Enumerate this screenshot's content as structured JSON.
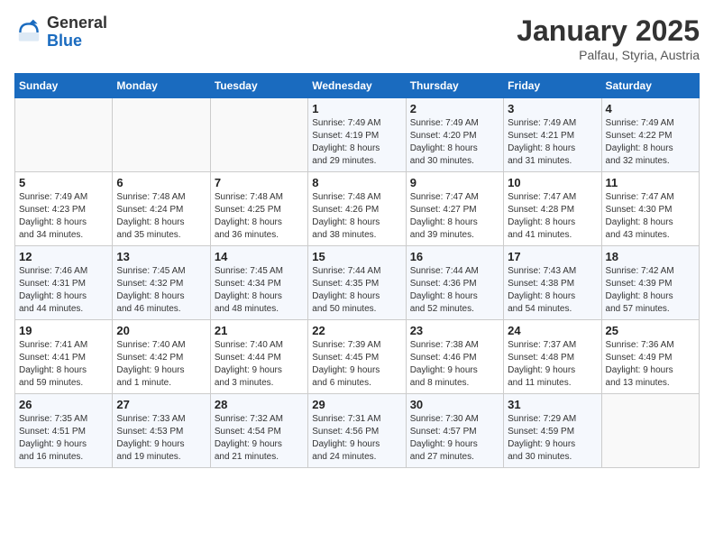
{
  "logo": {
    "general": "General",
    "blue": "Blue"
  },
  "header": {
    "month": "January 2025",
    "location": "Palfau, Styria, Austria"
  },
  "weekdays": [
    "Sunday",
    "Monday",
    "Tuesday",
    "Wednesday",
    "Thursday",
    "Friday",
    "Saturday"
  ],
  "weeks": [
    [
      {
        "day": "",
        "content": ""
      },
      {
        "day": "",
        "content": ""
      },
      {
        "day": "",
        "content": ""
      },
      {
        "day": "1",
        "content": "Sunrise: 7:49 AM\nSunset: 4:19 PM\nDaylight: 8 hours\nand 29 minutes."
      },
      {
        "day": "2",
        "content": "Sunrise: 7:49 AM\nSunset: 4:20 PM\nDaylight: 8 hours\nand 30 minutes."
      },
      {
        "day": "3",
        "content": "Sunrise: 7:49 AM\nSunset: 4:21 PM\nDaylight: 8 hours\nand 31 minutes."
      },
      {
        "day": "4",
        "content": "Sunrise: 7:49 AM\nSunset: 4:22 PM\nDaylight: 8 hours\nand 32 minutes."
      }
    ],
    [
      {
        "day": "5",
        "content": "Sunrise: 7:49 AM\nSunset: 4:23 PM\nDaylight: 8 hours\nand 34 minutes."
      },
      {
        "day": "6",
        "content": "Sunrise: 7:48 AM\nSunset: 4:24 PM\nDaylight: 8 hours\nand 35 minutes."
      },
      {
        "day": "7",
        "content": "Sunrise: 7:48 AM\nSunset: 4:25 PM\nDaylight: 8 hours\nand 36 minutes."
      },
      {
        "day": "8",
        "content": "Sunrise: 7:48 AM\nSunset: 4:26 PM\nDaylight: 8 hours\nand 38 minutes."
      },
      {
        "day": "9",
        "content": "Sunrise: 7:47 AM\nSunset: 4:27 PM\nDaylight: 8 hours\nand 39 minutes."
      },
      {
        "day": "10",
        "content": "Sunrise: 7:47 AM\nSunset: 4:28 PM\nDaylight: 8 hours\nand 41 minutes."
      },
      {
        "day": "11",
        "content": "Sunrise: 7:47 AM\nSunset: 4:30 PM\nDaylight: 8 hours\nand 43 minutes."
      }
    ],
    [
      {
        "day": "12",
        "content": "Sunrise: 7:46 AM\nSunset: 4:31 PM\nDaylight: 8 hours\nand 44 minutes."
      },
      {
        "day": "13",
        "content": "Sunrise: 7:45 AM\nSunset: 4:32 PM\nDaylight: 8 hours\nand 46 minutes."
      },
      {
        "day": "14",
        "content": "Sunrise: 7:45 AM\nSunset: 4:34 PM\nDaylight: 8 hours\nand 48 minutes."
      },
      {
        "day": "15",
        "content": "Sunrise: 7:44 AM\nSunset: 4:35 PM\nDaylight: 8 hours\nand 50 minutes."
      },
      {
        "day": "16",
        "content": "Sunrise: 7:44 AM\nSunset: 4:36 PM\nDaylight: 8 hours\nand 52 minutes."
      },
      {
        "day": "17",
        "content": "Sunrise: 7:43 AM\nSunset: 4:38 PM\nDaylight: 8 hours\nand 54 minutes."
      },
      {
        "day": "18",
        "content": "Sunrise: 7:42 AM\nSunset: 4:39 PM\nDaylight: 8 hours\nand 57 minutes."
      }
    ],
    [
      {
        "day": "19",
        "content": "Sunrise: 7:41 AM\nSunset: 4:41 PM\nDaylight: 8 hours\nand 59 minutes."
      },
      {
        "day": "20",
        "content": "Sunrise: 7:40 AM\nSunset: 4:42 PM\nDaylight: 9 hours\nand 1 minute."
      },
      {
        "day": "21",
        "content": "Sunrise: 7:40 AM\nSunset: 4:44 PM\nDaylight: 9 hours\nand 3 minutes."
      },
      {
        "day": "22",
        "content": "Sunrise: 7:39 AM\nSunset: 4:45 PM\nDaylight: 9 hours\nand 6 minutes."
      },
      {
        "day": "23",
        "content": "Sunrise: 7:38 AM\nSunset: 4:46 PM\nDaylight: 9 hours\nand 8 minutes."
      },
      {
        "day": "24",
        "content": "Sunrise: 7:37 AM\nSunset: 4:48 PM\nDaylight: 9 hours\nand 11 minutes."
      },
      {
        "day": "25",
        "content": "Sunrise: 7:36 AM\nSunset: 4:49 PM\nDaylight: 9 hours\nand 13 minutes."
      }
    ],
    [
      {
        "day": "26",
        "content": "Sunrise: 7:35 AM\nSunset: 4:51 PM\nDaylight: 9 hours\nand 16 minutes."
      },
      {
        "day": "27",
        "content": "Sunrise: 7:33 AM\nSunset: 4:53 PM\nDaylight: 9 hours\nand 19 minutes."
      },
      {
        "day": "28",
        "content": "Sunrise: 7:32 AM\nSunset: 4:54 PM\nDaylight: 9 hours\nand 21 minutes."
      },
      {
        "day": "29",
        "content": "Sunrise: 7:31 AM\nSunset: 4:56 PM\nDaylight: 9 hours\nand 24 minutes."
      },
      {
        "day": "30",
        "content": "Sunrise: 7:30 AM\nSunset: 4:57 PM\nDaylight: 9 hours\nand 27 minutes."
      },
      {
        "day": "31",
        "content": "Sunrise: 7:29 AM\nSunset: 4:59 PM\nDaylight: 9 hours\nand 30 minutes."
      },
      {
        "day": "",
        "content": ""
      }
    ]
  ]
}
